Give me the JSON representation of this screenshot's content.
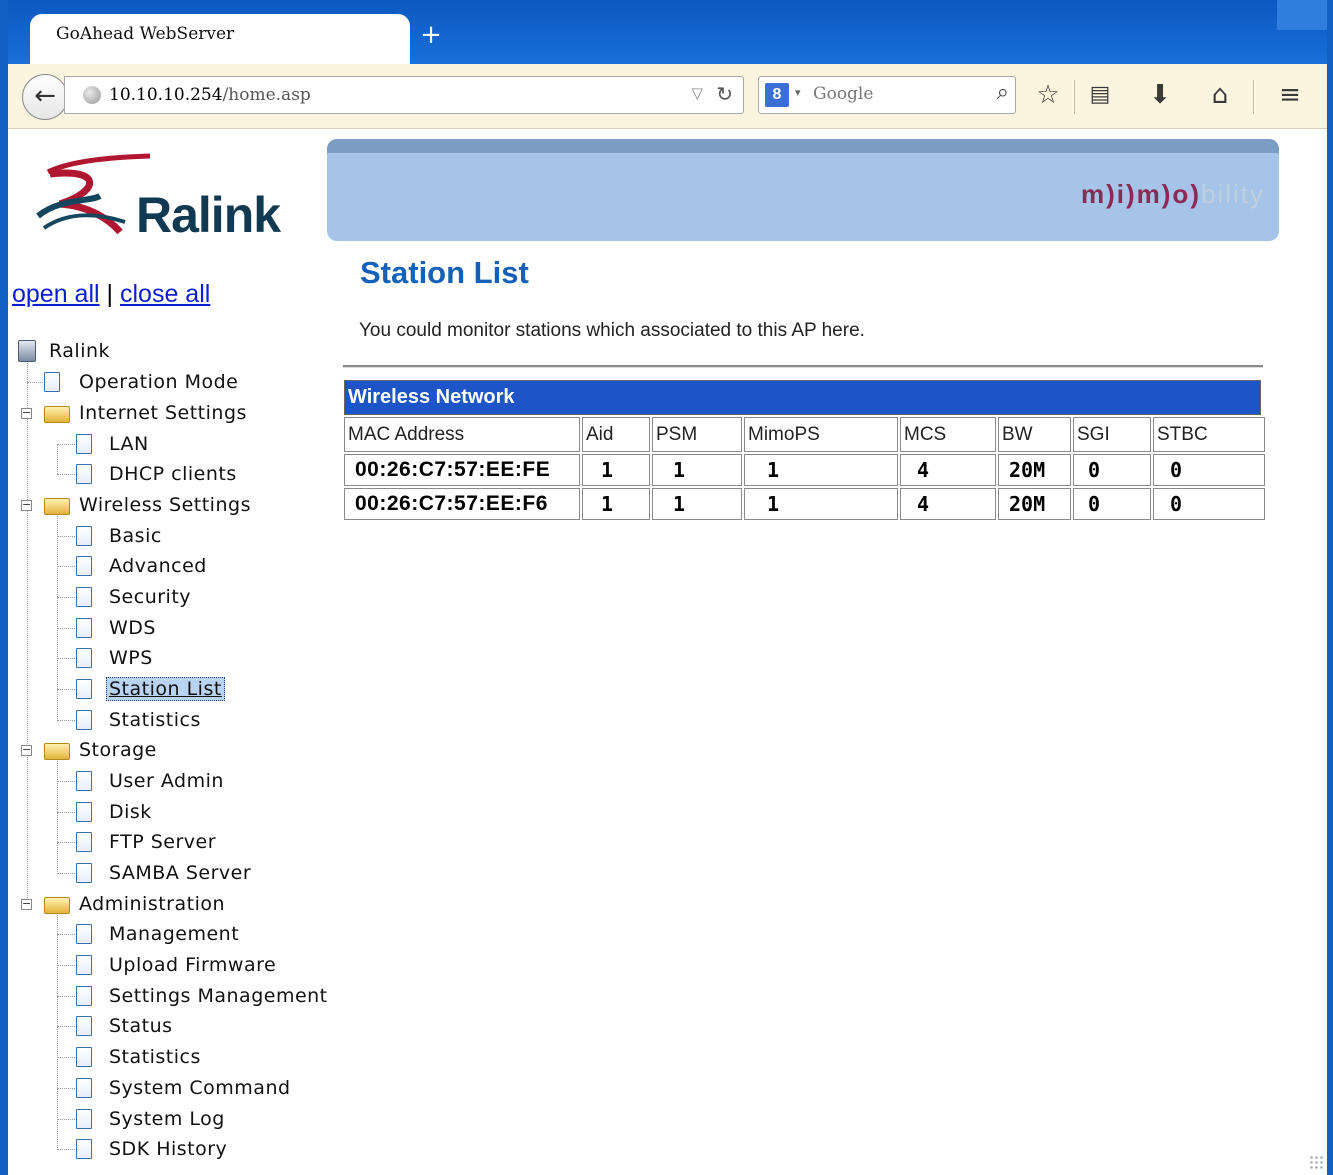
{
  "browser": {
    "tab_title": "GoAhead WebServer",
    "new_tab": "+",
    "url_host": "10.10.10.254",
    "url_path": "/home.asp",
    "search_placeholder": "Google",
    "search_engine_badge": "8"
  },
  "brand": {
    "logo_text": "Ralink",
    "banner_mark_bold": "m)i)m)o)",
    "banner_mark_light": "bility"
  },
  "tree_controls": {
    "open_all": "open all",
    "separator": "|",
    "close_all": "close all"
  },
  "tree": {
    "root": "Ralink",
    "items": [
      {
        "label": "Operation Mode"
      },
      {
        "label": "Internet Settings"
      },
      {
        "label": "LAN"
      },
      {
        "label": "DHCP clients"
      },
      {
        "label": "Wireless Settings"
      },
      {
        "label": "Basic"
      },
      {
        "label": "Advanced"
      },
      {
        "label": "Security"
      },
      {
        "label": "WDS"
      },
      {
        "label": "WPS"
      },
      {
        "label": "Station List"
      },
      {
        "label": "Statistics"
      },
      {
        "label": "Storage"
      },
      {
        "label": "User Admin"
      },
      {
        "label": "Disk"
      },
      {
        "label": "FTP Server"
      },
      {
        "label": "SAMBA Server"
      },
      {
        "label": "Administration"
      },
      {
        "label": "Management"
      },
      {
        "label": "Upload Firmware"
      },
      {
        "label": "Settings Management"
      },
      {
        "label": "Status"
      },
      {
        "label": "Statistics"
      },
      {
        "label": "System Command"
      },
      {
        "label": "System Log"
      },
      {
        "label": "SDK History"
      }
    ]
  },
  "main": {
    "title": "Station List",
    "description": "You could monitor stations which associated to this AP here.",
    "section_header": "Wireless Network",
    "columns": [
      "MAC Address",
      "Aid",
      "PSM",
      "MimoPS",
      "MCS",
      "BW",
      "SGI",
      "STBC"
    ],
    "rows": [
      [
        "00:26:C7:57:EE:FE",
        "1",
        "1",
        "1",
        "4",
        "20M",
        "0",
        "0"
      ],
      [
        "00:26:C7:57:EE:F6",
        "1",
        "1",
        "1",
        "4",
        "20M",
        "0",
        "0"
      ]
    ]
  },
  "colors": {
    "heading": "#1560b8",
    "section_header_bg": "#1d55c9",
    "link": "#0b1fd1",
    "browser_chrome": "#1160c4"
  }
}
